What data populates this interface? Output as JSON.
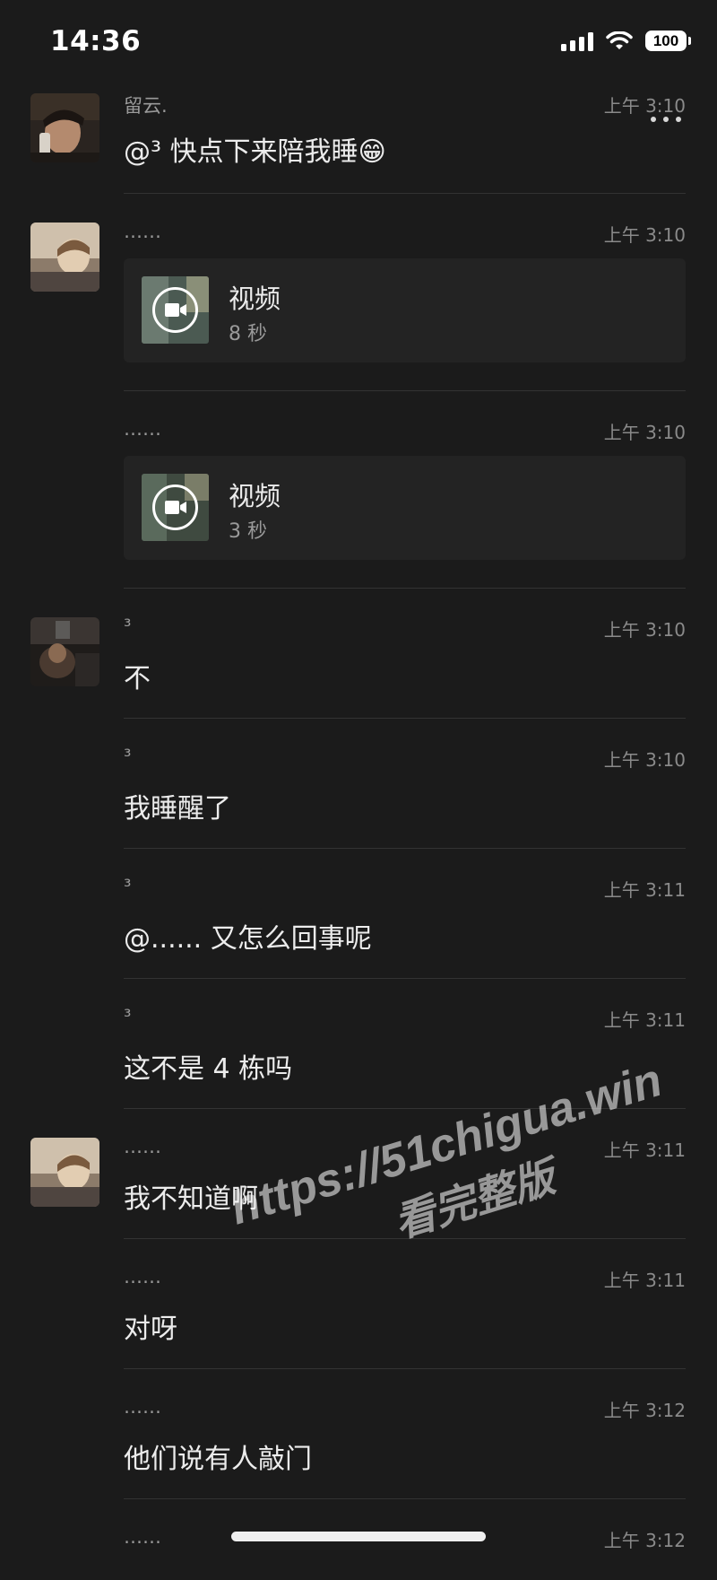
{
  "status_bar": {
    "time": "14:36",
    "battery": "100"
  },
  "messages": [
    {
      "sender": "留云.",
      "time": "上午 3:10",
      "text": "@³ 快点下来陪我睡😁",
      "avatar": "avatar-man-phone"
    },
    {
      "sender": "……",
      "time": "上午 3:10",
      "video": {
        "title": "视频",
        "duration": "8 秒"
      },
      "avatar": "avatar-boy-light"
    },
    {
      "sender": "……",
      "time": "上午 3:10",
      "video": {
        "title": "视频",
        "duration": "3 秒"
      }
    },
    {
      "sender": "³",
      "time": "上午 3:10",
      "text": "不",
      "avatar": "avatar-dark-room"
    },
    {
      "sender": "³",
      "time": "上午 3:10",
      "text": "我睡醒了"
    },
    {
      "sender": "³",
      "time": "上午 3:11",
      "text": "@...... 又怎么回事呢"
    },
    {
      "sender": "³",
      "time": "上午 3:11",
      "text": "这不是 4 栋吗"
    },
    {
      "sender": "……",
      "time": "上午 3:11",
      "text": "我不知道啊",
      "avatar": "avatar-boy-light"
    },
    {
      "sender": "……",
      "time": "上午 3:11",
      "text": "对呀"
    },
    {
      "sender": "……",
      "time": "上午 3:12",
      "text": "他们说有人敲门"
    },
    {
      "sender": "……",
      "time": "上午 3:12"
    }
  ],
  "watermark": {
    "line1": "https://51chigua.win",
    "line2": "看完整版"
  },
  "colors": {
    "background": "#1b1b1b",
    "card": "#232323",
    "text": "#ececec",
    "muted": "#8a8a8a"
  },
  "icons": [
    "more-dots-icon",
    "video-camera-icon",
    "signal-icon",
    "wifi-icon",
    "battery-icon"
  ]
}
